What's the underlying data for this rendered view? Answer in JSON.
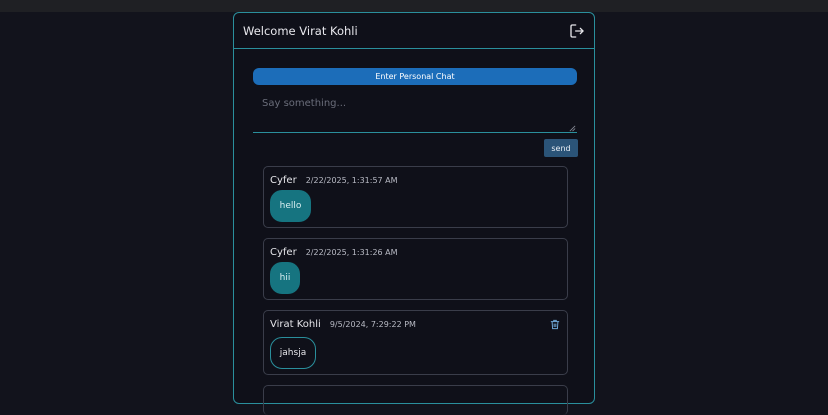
{
  "header": {
    "title": "Welcome Virat Kohli",
    "logout_icon": "logout-icon"
  },
  "composer": {
    "personal_chat_label": "Enter Personal Chat",
    "placeholder": "Say something...",
    "send_label": "send"
  },
  "messages": [
    {
      "author": "Cyfer",
      "time": "2/22/2025, 1:31:57 AM",
      "text": "hello",
      "own": false
    },
    {
      "author": "Cyfer",
      "time": "2/22/2025, 1:31:26 AM",
      "text": "hii",
      "own": false
    },
    {
      "author": "Virat Kohli",
      "time": "9/5/2024, 7:29:22 PM",
      "text": "jahsja",
      "own": true,
      "action_icon": "trash-icon"
    }
  ],
  "colors": {
    "accent": "#2a8f9c",
    "primary_button": "#1c6db9",
    "bubble_other": "#167480",
    "send_button": "#2b5478"
  }
}
